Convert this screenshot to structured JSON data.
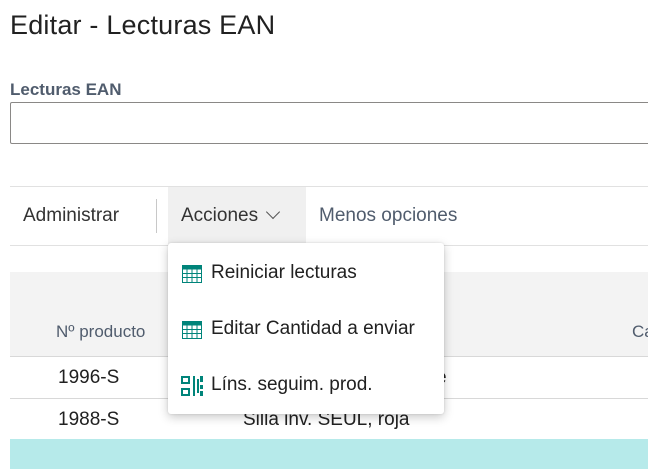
{
  "page": {
    "title": "Editar - Lecturas EAN",
    "field_label": "Lecturas EAN",
    "field_value": ""
  },
  "action_bar": {
    "administrar": "Administrar",
    "acciones": "Acciones",
    "menos_opciones": "Menos opciones"
  },
  "grid": {
    "columns": [
      "Nº producto",
      "Ca"
    ],
    "rows": [
      {
        "product_no": "1996-S",
        "description": "e"
      },
      {
        "product_no": "1988-S",
        "description": "Silla inv. SEUL, roja"
      }
    ]
  },
  "menu": {
    "items": [
      {
        "label": "Reiniciar lecturas",
        "icon": "table-grid-icon"
      },
      {
        "label": "Editar Cantidad a enviar",
        "icon": "table-grid-icon"
      },
      {
        "label": "Líns. seguim. prod.",
        "icon": "tracking-lines-icon"
      }
    ]
  },
  "colors": {
    "accent_teal": "#00847a",
    "selected_row": "#b6eaea",
    "menu_hover": "#f0f0f0"
  }
}
